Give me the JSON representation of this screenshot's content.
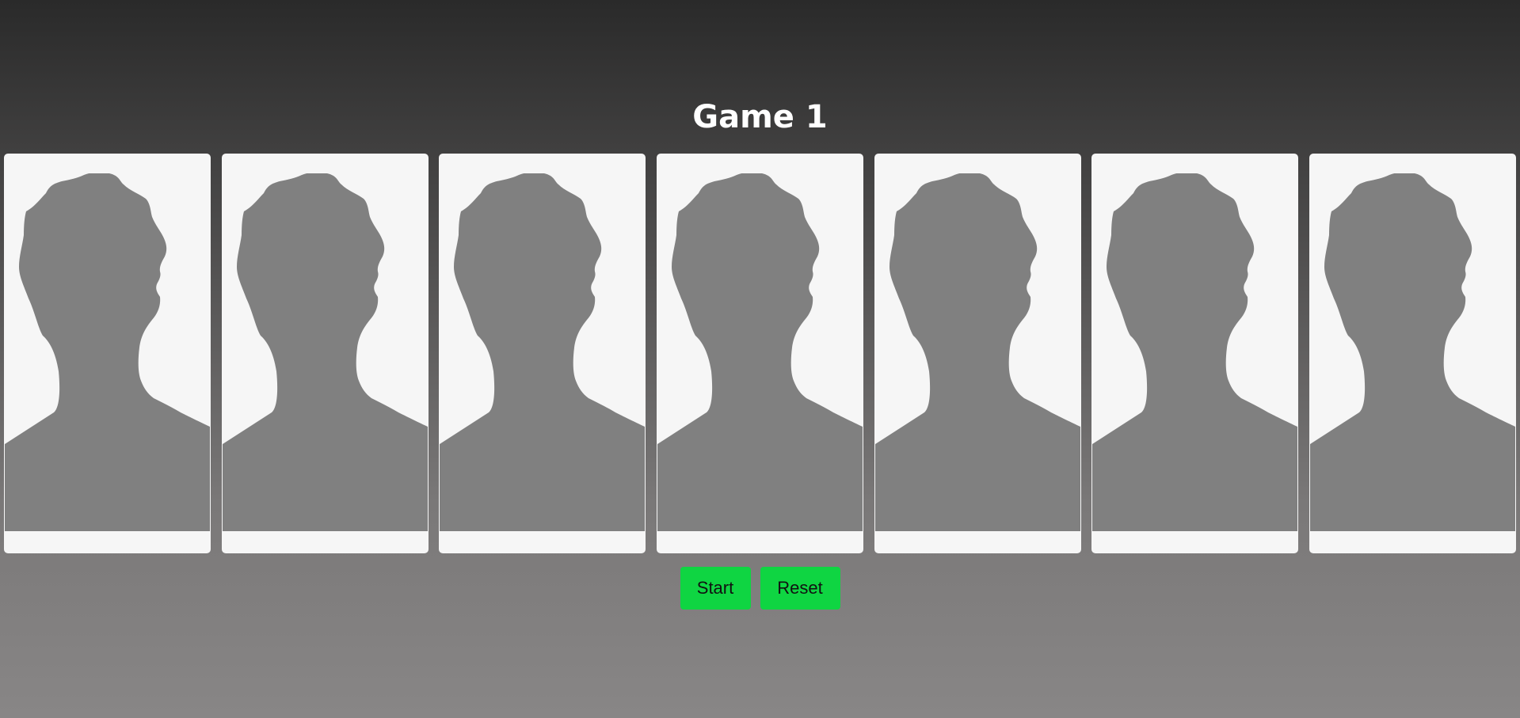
{
  "game": {
    "title": "Game 1"
  },
  "cards": [
    {
      "image": "person-silhouette-icon"
    },
    {
      "image": "person-silhouette-icon"
    },
    {
      "image": "person-silhouette-icon"
    },
    {
      "image": "person-silhouette-icon"
    },
    {
      "image": "person-silhouette-icon"
    },
    {
      "image": "person-silhouette-icon"
    },
    {
      "image": "person-silhouette-icon"
    }
  ],
  "controls": {
    "start_label": "Start",
    "reset_label": "Reset"
  },
  "colors": {
    "button": "#0fd542",
    "card_background": "#f6f6f6",
    "silhouette": "#808080"
  }
}
